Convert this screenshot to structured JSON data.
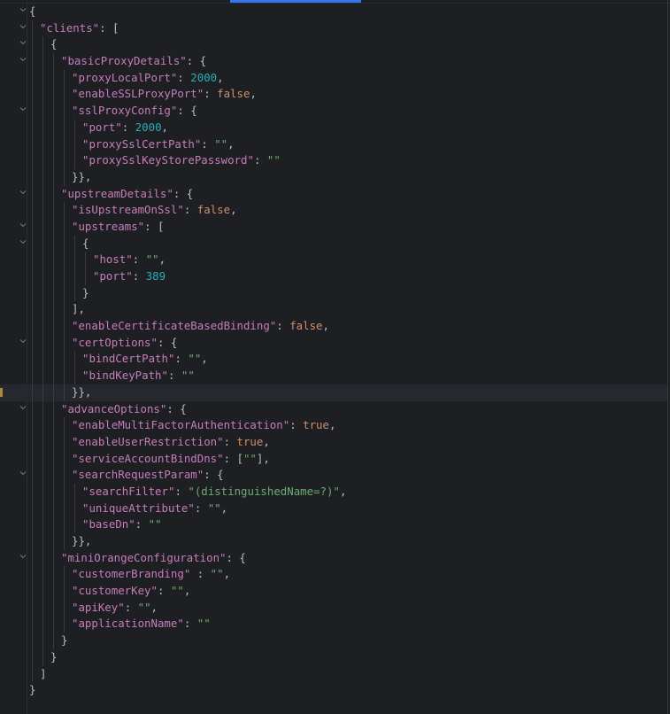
{
  "editor": {
    "current_line": 24,
    "colors": {
      "key": "#c77dbb",
      "number": "#2aacb8",
      "boolean": "#cf8e6d",
      "string": "#6aab73",
      "punct": "#bcbec4",
      "background": "#1e1f22",
      "tab_accent": "#3574f0"
    },
    "lines": [
      {
        "lvl": 0,
        "fold": true,
        "t": [
          [
            "p",
            "{"
          ]
        ]
      },
      {
        "lvl": 1,
        "fold": true,
        "t": [
          [
            "k",
            "\"clients\""
          ],
          [
            "p",
            ": ["
          ]
        ]
      },
      {
        "lvl": 2,
        "fold": true,
        "t": [
          [
            "p",
            "{"
          ]
        ]
      },
      {
        "lvl": 3,
        "fold": true,
        "t": [
          [
            "k",
            "\"basicProxyDetails\""
          ],
          [
            "p",
            ": {"
          ]
        ]
      },
      {
        "lvl": 4,
        "t": [
          [
            "k",
            "\"proxyLocalPort\""
          ],
          [
            "p",
            ": "
          ],
          [
            "n",
            "2000"
          ],
          [
            "p",
            ","
          ]
        ]
      },
      {
        "lvl": 4,
        "t": [
          [
            "k",
            "\"enableSSLProxyPort\""
          ],
          [
            "p",
            ": "
          ],
          [
            "b",
            "false"
          ],
          [
            "p",
            ","
          ]
        ]
      },
      {
        "lvl": 4,
        "fold": true,
        "t": [
          [
            "k",
            "\"sslProxyConfig\""
          ],
          [
            "p",
            ": {"
          ]
        ]
      },
      {
        "lvl": 5,
        "t": [
          [
            "k",
            "\"port\""
          ],
          [
            "p",
            ": "
          ],
          [
            "n",
            "2000"
          ],
          [
            "p",
            ","
          ]
        ]
      },
      {
        "lvl": 5,
        "t": [
          [
            "k",
            "\"proxySslCertPath\""
          ],
          [
            "p",
            ": "
          ],
          [
            "s",
            "\"\""
          ],
          [
            "p",
            ","
          ]
        ]
      },
      {
        "lvl": 5,
        "t": [
          [
            "k",
            "\"proxySslKeyStorePassword\""
          ],
          [
            "p",
            ": "
          ],
          [
            "s",
            "\"\""
          ]
        ]
      },
      {
        "lvl": 4,
        "t": [
          [
            "p",
            "}},"
          ]
        ]
      },
      {
        "lvl": 3,
        "fold": true,
        "t": [
          [
            "k",
            "\"upstreamDetails\""
          ],
          [
            "p",
            ": {"
          ]
        ]
      },
      {
        "lvl": 4,
        "t": [
          [
            "k",
            "\"isUpstreamOnSsl\""
          ],
          [
            "p",
            ": "
          ],
          [
            "b",
            "false"
          ],
          [
            "p",
            ","
          ]
        ]
      },
      {
        "lvl": 4,
        "fold": true,
        "t": [
          [
            "k",
            "\"upstreams\""
          ],
          [
            "p",
            ": ["
          ]
        ]
      },
      {
        "lvl": 5,
        "fold": true,
        "t": [
          [
            "p",
            "{"
          ]
        ]
      },
      {
        "lvl": 6,
        "t": [
          [
            "k",
            "\"host\""
          ],
          [
            "p",
            ": "
          ],
          [
            "s",
            "\"\""
          ],
          [
            "p",
            ","
          ]
        ]
      },
      {
        "lvl": 6,
        "t": [
          [
            "k",
            "\"port\""
          ],
          [
            "p",
            ": "
          ],
          [
            "n",
            "389"
          ]
        ]
      },
      {
        "lvl": 5,
        "t": [
          [
            "p",
            "}"
          ]
        ]
      },
      {
        "lvl": 4,
        "t": [
          [
            "p",
            "],"
          ]
        ]
      },
      {
        "lvl": 4,
        "t": [
          [
            "k",
            "\"enableCertificateBasedBinding\""
          ],
          [
            "p",
            ": "
          ],
          [
            "b",
            "false"
          ],
          [
            "p",
            ","
          ]
        ]
      },
      {
        "lvl": 4,
        "fold": true,
        "t": [
          [
            "k",
            "\"certOptions\""
          ],
          [
            "p",
            ": {"
          ]
        ]
      },
      {
        "lvl": 5,
        "t": [
          [
            "k",
            "\"bindCertPath\""
          ],
          [
            "p",
            ": "
          ],
          [
            "s",
            "\"\""
          ],
          [
            "p",
            ","
          ]
        ]
      },
      {
        "lvl": 5,
        "t": [
          [
            "k",
            "\"bindKeyPath\""
          ],
          [
            "p",
            ": "
          ],
          [
            "s",
            "\"\""
          ]
        ]
      },
      {
        "lvl": 4,
        "t": [
          [
            "p",
            "}},"
          ]
        ]
      },
      {
        "lvl": 3,
        "fold": true,
        "t": [
          [
            "k",
            "\"advanceOptions\""
          ],
          [
            "p",
            ": {"
          ]
        ]
      },
      {
        "lvl": 4,
        "t": [
          [
            "k",
            "\"enableMultiFactorAuthentication\""
          ],
          [
            "p",
            ": "
          ],
          [
            "b",
            "true"
          ],
          [
            "p",
            ","
          ]
        ]
      },
      {
        "lvl": 4,
        "t": [
          [
            "k",
            "\"enableUserRestriction\""
          ],
          [
            "p",
            ": "
          ],
          [
            "b",
            "true"
          ],
          [
            "p",
            ","
          ]
        ]
      },
      {
        "lvl": 4,
        "t": [
          [
            "k",
            "\"serviceAccountBindDns\""
          ],
          [
            "p",
            ": ["
          ],
          [
            "s",
            "\"\""
          ],
          [
            "p",
            "],"
          ]
        ]
      },
      {
        "lvl": 4,
        "fold": true,
        "t": [
          [
            "k",
            "\"searchRequestParam\""
          ],
          [
            "p",
            ": {"
          ]
        ]
      },
      {
        "lvl": 5,
        "t": [
          [
            "k",
            "\"searchFilter\""
          ],
          [
            "p",
            ": "
          ],
          [
            "s",
            "\"(distinguishedName=?)\""
          ],
          [
            "p",
            ","
          ]
        ]
      },
      {
        "lvl": 5,
        "t": [
          [
            "k",
            "\"uniqueAttribute\""
          ],
          [
            "p",
            ": "
          ],
          [
            "s",
            "\"\""
          ],
          [
            "p",
            ","
          ]
        ]
      },
      {
        "lvl": 5,
        "t": [
          [
            "k",
            "\"baseDn\""
          ],
          [
            "p",
            ": "
          ],
          [
            "s",
            "\"\""
          ]
        ]
      },
      {
        "lvl": 4,
        "t": [
          [
            "p",
            "}},"
          ]
        ]
      },
      {
        "lvl": 3,
        "fold": true,
        "t": [
          [
            "k",
            "\"miniOrangeConfiguration\""
          ],
          [
            "p",
            ": {"
          ]
        ]
      },
      {
        "lvl": 4,
        "t": [
          [
            "k",
            "\"customerBranding\""
          ],
          [
            "p",
            " : "
          ],
          [
            "s",
            "\"\""
          ],
          [
            "p",
            ","
          ]
        ]
      },
      {
        "lvl": 4,
        "t": [
          [
            "k",
            "\"customerKey\""
          ],
          [
            "p",
            ": "
          ],
          [
            "s",
            "\"\""
          ],
          [
            "p",
            ","
          ]
        ]
      },
      {
        "lvl": 4,
        "t": [
          [
            "k",
            "\"apiKey\""
          ],
          [
            "p",
            ": "
          ],
          [
            "s",
            "\"\""
          ],
          [
            "p",
            ","
          ]
        ]
      },
      {
        "lvl": 4,
        "t": [
          [
            "k",
            "\"applicationName\""
          ],
          [
            "p",
            ": "
          ],
          [
            "s",
            "\"\""
          ]
        ]
      },
      {
        "lvl": 3,
        "t": [
          [
            "p",
            "}"
          ]
        ]
      },
      {
        "lvl": 2,
        "t": [
          [
            "p",
            "}"
          ]
        ]
      },
      {
        "lvl": 1,
        "t": [
          [
            "p",
            "]"
          ]
        ]
      },
      {
        "lvl": 0,
        "t": [
          [
            "p",
            "}"
          ]
        ]
      }
    ]
  }
}
